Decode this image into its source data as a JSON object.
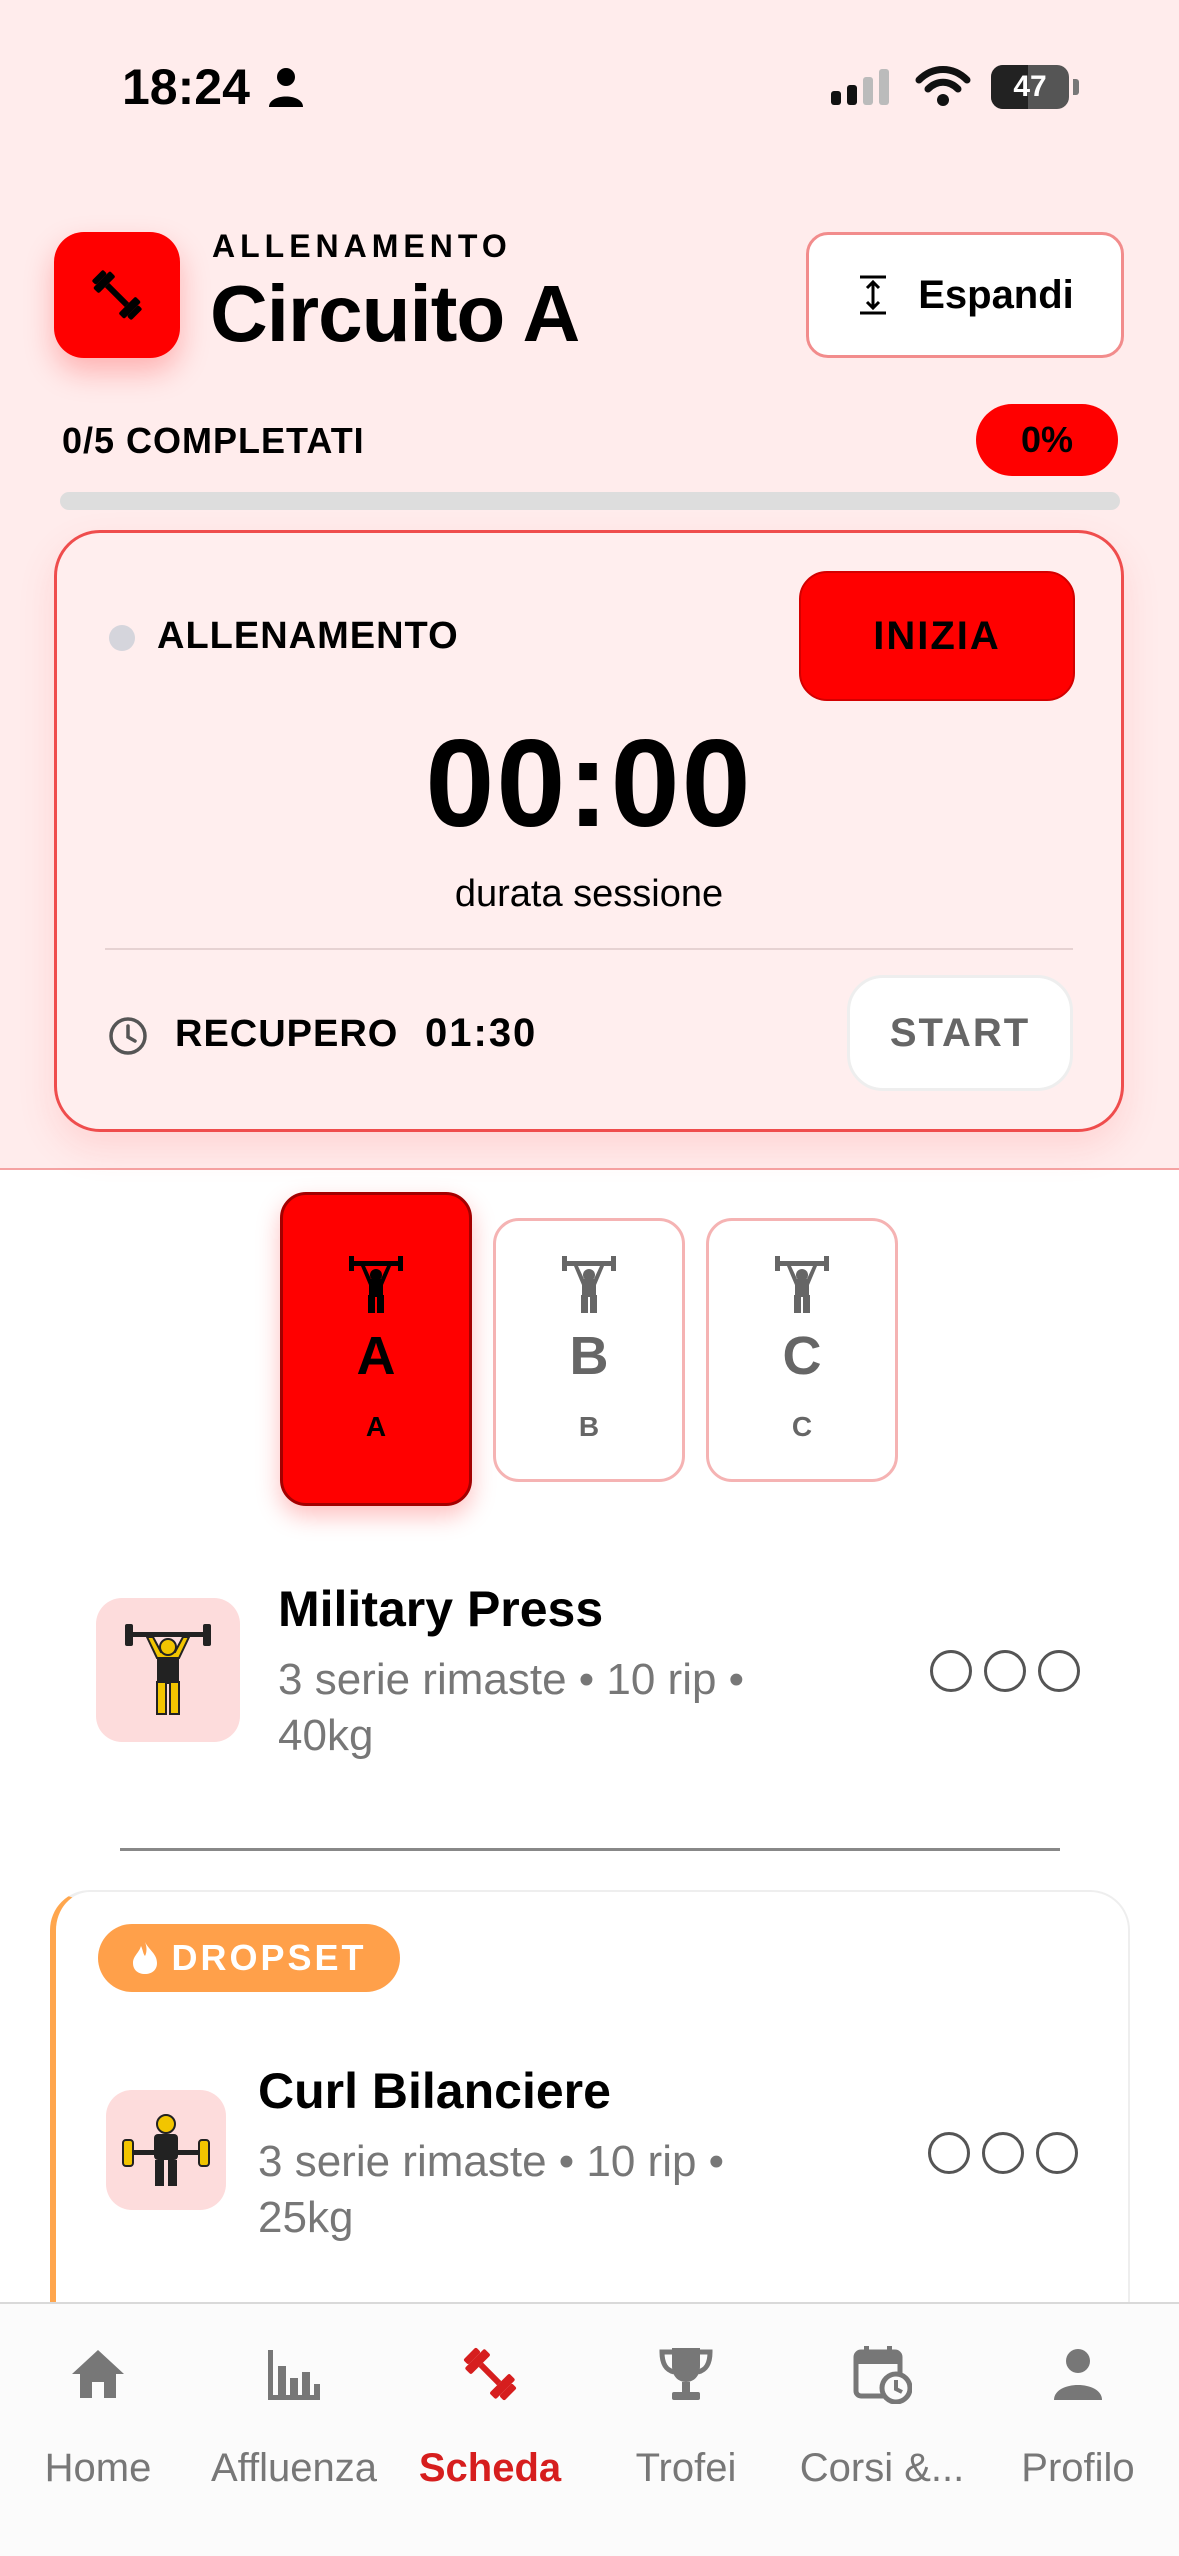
{
  "status_bar": {
    "time": "18:24",
    "battery": "47"
  },
  "header": {
    "kicker": "ALLENAMENTO",
    "title": "Circuito A",
    "expand_label": "Espandi",
    "progress_label": "0/5 COMPLETATI",
    "progress_percent": "0%",
    "progress_fraction": 0
  },
  "session_card": {
    "label": "ALLENAMENTO",
    "start_label": "INIZIA",
    "timer": "00:00",
    "timer_caption": "durata sessione",
    "rest_label": "RECUPERO",
    "rest_time": "01:30",
    "rest_start_label": "START"
  },
  "workout_tabs": [
    {
      "letter": "A",
      "sub": "A",
      "active": true
    },
    {
      "letter": "B",
      "sub": "B",
      "active": false
    },
    {
      "letter": "C",
      "sub": "C",
      "active": false
    }
  ],
  "exercises": [
    {
      "name": "Military Press",
      "meta": "3 serie rimaste • 10 rip • 40kg",
      "sets_total": 3,
      "sets_done": 0
    },
    {
      "badge": "DROPSET",
      "name": "Curl Bilanciere",
      "meta": "3 serie rimaste • 10 rip • 25kg",
      "sets_total": 3,
      "sets_done": 0
    }
  ],
  "tab_bar": [
    {
      "label": "Home",
      "icon": "home-icon",
      "active": false
    },
    {
      "label": "Affluenza",
      "icon": "bar-chart-icon",
      "active": false
    },
    {
      "label": "Scheda",
      "icon": "dumbbell-icon",
      "active": true
    },
    {
      "label": "Trofei",
      "icon": "trophy-icon",
      "active": false
    },
    {
      "label": "Corsi &...",
      "icon": "calendar-clock-icon",
      "active": false
    },
    {
      "label": "Profilo",
      "icon": "person-icon",
      "active": false
    }
  ],
  "colors": {
    "accent": "#ff0000",
    "background_top": "#ffecec",
    "dropset": "#ffa04a",
    "nav_active": "#d61e1e"
  }
}
